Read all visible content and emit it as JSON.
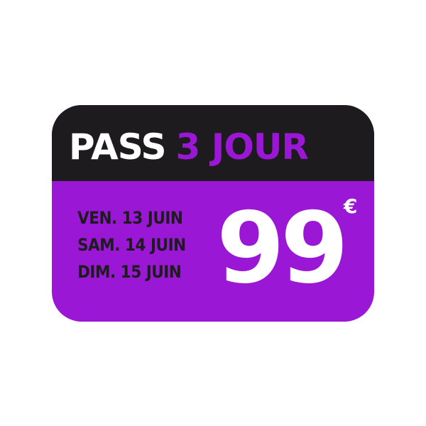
{
  "ticket": {
    "title_part1": "PASS",
    "title_part2": "3 JOUR",
    "dates": [
      "VEN. 13 JUIN",
      "SAM. 14 JUIN",
      "DIM. 15 JUIN"
    ],
    "price": "99",
    "currency": "€"
  },
  "colors": {
    "purple": "#9b17d6",
    "dark": "#1d1b1d",
    "white": "#ffffff"
  }
}
